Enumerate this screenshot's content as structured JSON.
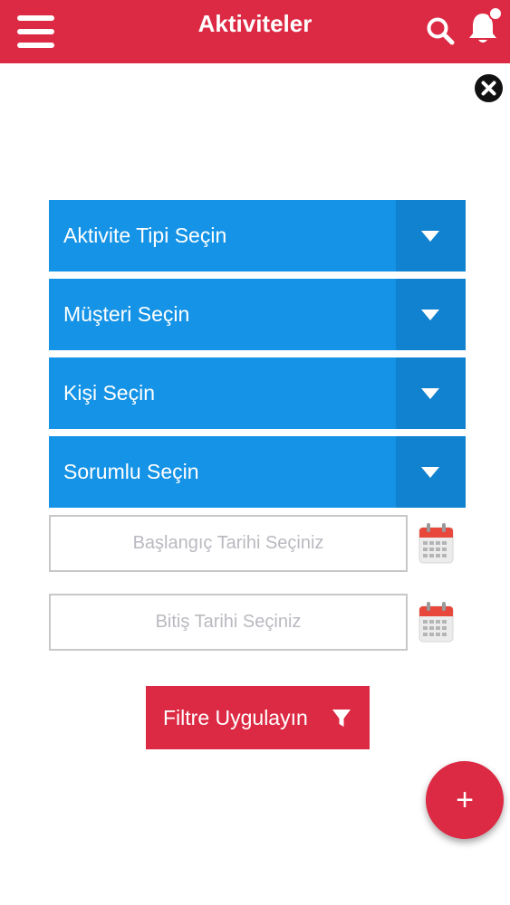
{
  "header": {
    "title": "Aktiviteler",
    "menu_icon": "hamburger-menu-icon",
    "search_icon": "search-icon",
    "notification_icon": "bell-icon",
    "background_color": "#dc2a44"
  },
  "close_icon": "close-icon",
  "filters": {
    "dropdowns": [
      {
        "label": "Aktivite Tipi Seçin"
      },
      {
        "label": "Müşteri Seçin"
      },
      {
        "label": "Kişi Seçin"
      },
      {
        "label": "Sorumlu Seçin"
      }
    ],
    "dropdown_color": "#1593e6",
    "dropdown_caret_color": "#1182d0",
    "start_date": {
      "value": "",
      "placeholder": "Başlangıç Tarihi Seçiniz"
    },
    "end_date": {
      "value": "",
      "placeholder": "Bitiş Tarihi Seçiniz"
    },
    "calendar_icon": "calendar-icon",
    "apply_button": {
      "label": "Filtre Uygulayın",
      "icon": "filter-icon"
    }
  },
  "fab": {
    "label": "+",
    "icon": "plus-icon"
  }
}
